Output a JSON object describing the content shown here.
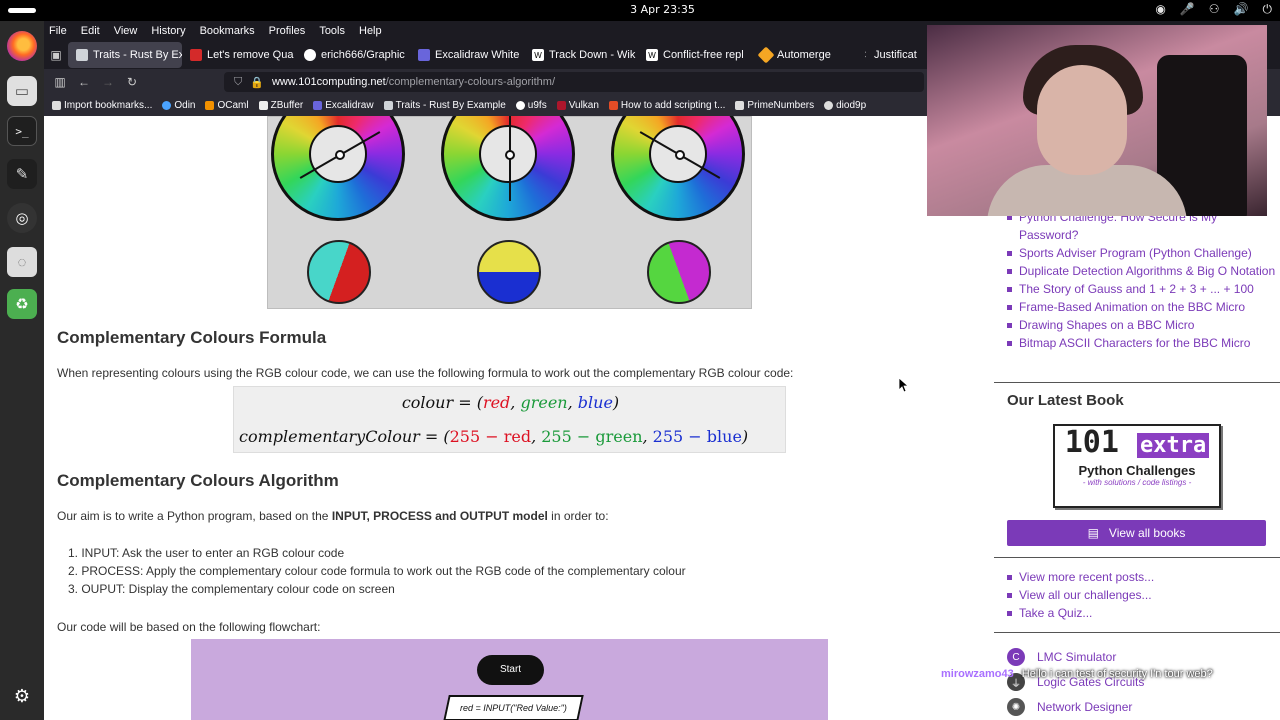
{
  "topbar": {
    "clock": "3 Apr 23:35"
  },
  "menubar": [
    "File",
    "Edit",
    "View",
    "History",
    "Bookmarks",
    "Profiles",
    "Tools",
    "Help"
  ],
  "tabs": [
    {
      "label": "Traits - Rust By Ex",
      "active": true,
      "color": "#cfd3d8"
    },
    {
      "label": "Let's remove Qua",
      "active": false,
      "color": "#d42a2a"
    },
    {
      "label": "erich666/Graphic",
      "active": false,
      "color": "#ffffff"
    },
    {
      "label": "Excalidraw White",
      "active": false,
      "color": "#6965db"
    },
    {
      "label": "Track Down - Wik",
      "active": false,
      "color": "#ffffff"
    },
    {
      "label": "Conflict-free repl",
      "active": false,
      "color": "#ffffff"
    },
    {
      "label": "Automerge",
      "active": false,
      "color": "#f5a623"
    },
    {
      "label": "Justificat",
      "active": false,
      "color": "#ffffff"
    }
  ],
  "url": {
    "host": "www.101computing.net",
    "path": "/complementary-colours-algorithm/"
  },
  "bookmarks": [
    {
      "label": "Import bookmarks...",
      "color": "#ddd"
    },
    {
      "label": "Odin",
      "color": "#4aa3ff"
    },
    {
      "label": "OCaml",
      "color": "#f29100"
    },
    {
      "label": "ZBuffer",
      "color": "#eee"
    },
    {
      "label": "Excalidraw",
      "color": "#6965db"
    },
    {
      "label": "Traits - Rust By Example",
      "color": "#cfd3d8"
    },
    {
      "label": "u9fs",
      "color": "#fff"
    },
    {
      "label": "Vulkan",
      "color": "#ac162c"
    },
    {
      "label": "How to add scripting t...",
      "color": "#e34c26"
    },
    {
      "label": "PrimeNumbers",
      "color": "#ddd"
    },
    {
      "label": "diod9p",
      "color": "#ddd"
    }
  ],
  "article": {
    "formula_heading": "Complementary Colours Formula",
    "formula_intro": "When representing colours using the RGB colour code, we can use the following formula to work out the complementary RGB colour code:",
    "formula_line1": {
      "lhs": "colour = (",
      "red": "red",
      "c1": ", ",
      "green": "green",
      "c2": ", ",
      "blue": "blue",
      "end": ")"
    },
    "formula_line2": {
      "lhs": "complementaryColour = (",
      "red": "255 − red",
      "c1": ", ",
      "green": "255 − green",
      "c2": ", ",
      "blue": "255  −  blue",
      "end": ")"
    },
    "algorithm_heading": "Complementary Colours Algorithm",
    "aim_prefix": "Our aim is to write a Python program, based on the ",
    "aim_bold": "INPUT, PROCESS and OUTPUT model",
    "aim_suffix": " in order to:",
    "steps": [
      "1. INPUT: Ask the user to enter an RGB colour code",
      "2. PROCESS: Apply the complementary colour code formula to work out the RGB code of the complementary colour",
      "3. OUPUT: Display the complementary colour code on screen"
    ],
    "flowchart_intro": "Our code will be based on the following flowchart:",
    "flow_start": "Start",
    "flow_input": "red = INPUT(\"Red Value:\")"
  },
  "sidebar": {
    "recent_posts": [
      "Python Challenge: How Secure is My Password?",
      "Sports Adviser Program (Python Challenge)",
      "Duplicate Detection Algorithms & Big O Notation",
      "The Story of Gauss and 1 + 2 + 3 + ... + 100",
      "Frame-Based Animation on the BBC Micro",
      "Drawing Shapes on a BBC Micro",
      "Bitmap ASCII Characters for the BBC Micro"
    ],
    "book_heading": "Our Latest Book",
    "book_cover": {
      "big": "101",
      "extra": "extra",
      "title": "Python Challenges",
      "subtitle": "- with solutions / code listings -"
    },
    "view_books": "View all books",
    "links": [
      "View more recent posts...",
      "View all our challenges...",
      "Take a Quiz..."
    ],
    "tools": [
      {
        "label": "LMC Simulator",
        "color": "#7b3ab8"
      },
      {
        "label": "Logic Gates Circuits",
        "color": "#444"
      },
      {
        "label": "Network Designer",
        "color": "#555"
      }
    ]
  },
  "chat": {
    "user": "mirowzamo43",
    "message": "Hello i can test of security I'n tour web?"
  }
}
